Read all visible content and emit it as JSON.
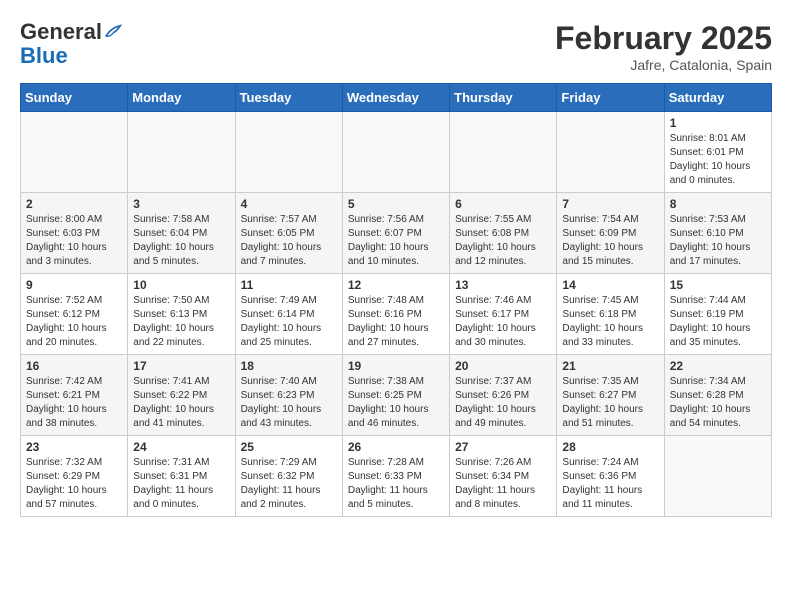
{
  "header": {
    "logo_general": "General",
    "logo_blue": "Blue",
    "month_title": "February 2025",
    "location": "Jafre, Catalonia, Spain"
  },
  "weekdays": [
    "Sunday",
    "Monday",
    "Tuesday",
    "Wednesday",
    "Thursday",
    "Friday",
    "Saturday"
  ],
  "weeks": [
    [
      {
        "day": "",
        "info": ""
      },
      {
        "day": "",
        "info": ""
      },
      {
        "day": "",
        "info": ""
      },
      {
        "day": "",
        "info": ""
      },
      {
        "day": "",
        "info": ""
      },
      {
        "day": "",
        "info": ""
      },
      {
        "day": "1",
        "info": "Sunrise: 8:01 AM\nSunset: 6:01 PM\nDaylight: 10 hours\nand 0 minutes."
      }
    ],
    [
      {
        "day": "2",
        "info": "Sunrise: 8:00 AM\nSunset: 6:03 PM\nDaylight: 10 hours\nand 3 minutes."
      },
      {
        "day": "3",
        "info": "Sunrise: 7:58 AM\nSunset: 6:04 PM\nDaylight: 10 hours\nand 5 minutes."
      },
      {
        "day": "4",
        "info": "Sunrise: 7:57 AM\nSunset: 6:05 PM\nDaylight: 10 hours\nand 7 minutes."
      },
      {
        "day": "5",
        "info": "Sunrise: 7:56 AM\nSunset: 6:07 PM\nDaylight: 10 hours\nand 10 minutes."
      },
      {
        "day": "6",
        "info": "Sunrise: 7:55 AM\nSunset: 6:08 PM\nDaylight: 10 hours\nand 12 minutes."
      },
      {
        "day": "7",
        "info": "Sunrise: 7:54 AM\nSunset: 6:09 PM\nDaylight: 10 hours\nand 15 minutes."
      },
      {
        "day": "8",
        "info": "Sunrise: 7:53 AM\nSunset: 6:10 PM\nDaylight: 10 hours\nand 17 minutes."
      }
    ],
    [
      {
        "day": "9",
        "info": "Sunrise: 7:52 AM\nSunset: 6:12 PM\nDaylight: 10 hours\nand 20 minutes."
      },
      {
        "day": "10",
        "info": "Sunrise: 7:50 AM\nSunset: 6:13 PM\nDaylight: 10 hours\nand 22 minutes."
      },
      {
        "day": "11",
        "info": "Sunrise: 7:49 AM\nSunset: 6:14 PM\nDaylight: 10 hours\nand 25 minutes."
      },
      {
        "day": "12",
        "info": "Sunrise: 7:48 AM\nSunset: 6:16 PM\nDaylight: 10 hours\nand 27 minutes."
      },
      {
        "day": "13",
        "info": "Sunrise: 7:46 AM\nSunset: 6:17 PM\nDaylight: 10 hours\nand 30 minutes."
      },
      {
        "day": "14",
        "info": "Sunrise: 7:45 AM\nSunset: 6:18 PM\nDaylight: 10 hours\nand 33 minutes."
      },
      {
        "day": "15",
        "info": "Sunrise: 7:44 AM\nSunset: 6:19 PM\nDaylight: 10 hours\nand 35 minutes."
      }
    ],
    [
      {
        "day": "16",
        "info": "Sunrise: 7:42 AM\nSunset: 6:21 PM\nDaylight: 10 hours\nand 38 minutes."
      },
      {
        "day": "17",
        "info": "Sunrise: 7:41 AM\nSunset: 6:22 PM\nDaylight: 10 hours\nand 41 minutes."
      },
      {
        "day": "18",
        "info": "Sunrise: 7:40 AM\nSunset: 6:23 PM\nDaylight: 10 hours\nand 43 minutes."
      },
      {
        "day": "19",
        "info": "Sunrise: 7:38 AM\nSunset: 6:25 PM\nDaylight: 10 hours\nand 46 minutes."
      },
      {
        "day": "20",
        "info": "Sunrise: 7:37 AM\nSunset: 6:26 PM\nDaylight: 10 hours\nand 49 minutes."
      },
      {
        "day": "21",
        "info": "Sunrise: 7:35 AM\nSunset: 6:27 PM\nDaylight: 10 hours\nand 51 minutes."
      },
      {
        "day": "22",
        "info": "Sunrise: 7:34 AM\nSunset: 6:28 PM\nDaylight: 10 hours\nand 54 minutes."
      }
    ],
    [
      {
        "day": "23",
        "info": "Sunrise: 7:32 AM\nSunset: 6:29 PM\nDaylight: 10 hours\nand 57 minutes."
      },
      {
        "day": "24",
        "info": "Sunrise: 7:31 AM\nSunset: 6:31 PM\nDaylight: 11 hours\nand 0 minutes."
      },
      {
        "day": "25",
        "info": "Sunrise: 7:29 AM\nSunset: 6:32 PM\nDaylight: 11 hours\nand 2 minutes."
      },
      {
        "day": "26",
        "info": "Sunrise: 7:28 AM\nSunset: 6:33 PM\nDaylight: 11 hours\nand 5 minutes."
      },
      {
        "day": "27",
        "info": "Sunrise: 7:26 AM\nSunset: 6:34 PM\nDaylight: 11 hours\nand 8 minutes."
      },
      {
        "day": "28",
        "info": "Sunrise: 7:24 AM\nSunset: 6:36 PM\nDaylight: 11 hours\nand 11 minutes."
      },
      {
        "day": "",
        "info": ""
      }
    ]
  ]
}
